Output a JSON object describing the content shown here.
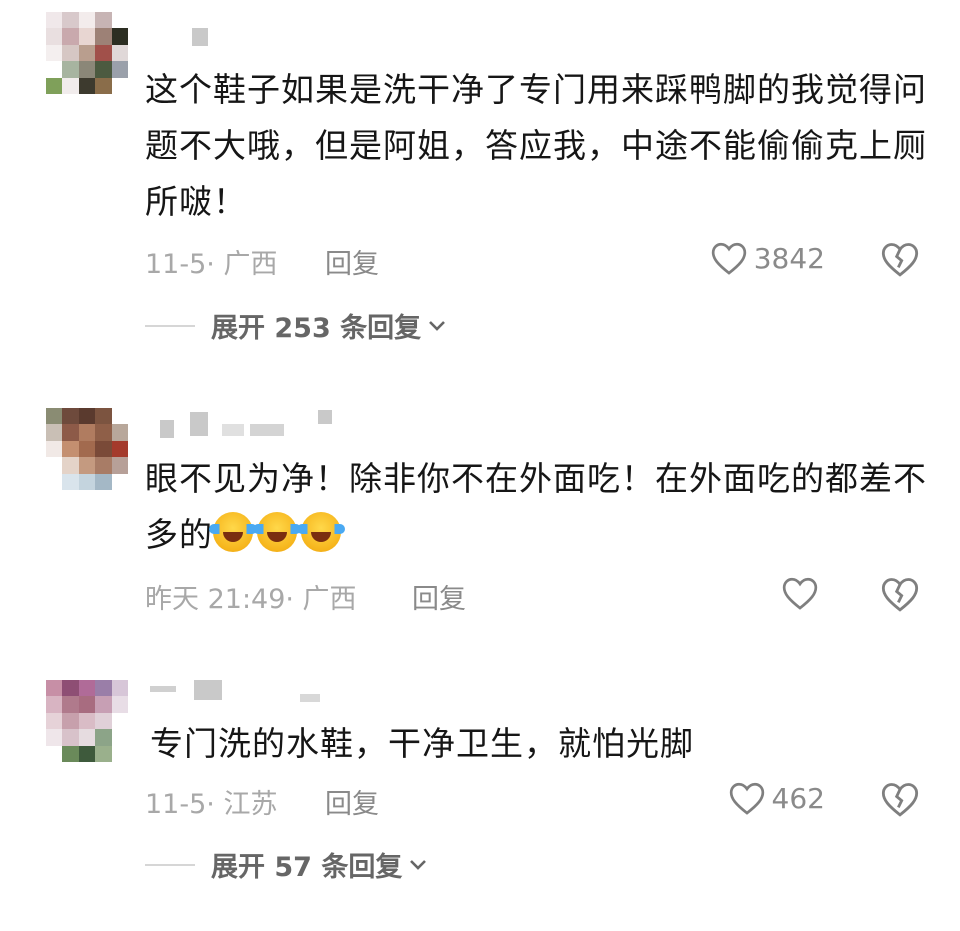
{
  "comments": [
    {
      "text": "这个鞋子如果是洗干净了专门用来踩鸭脚的我觉得问题不大哦，但是阿姐，答应我，中途不能偷偷克上厕所啵！",
      "meta": "11-5· 广西",
      "reply_label": "回复",
      "likes": "3842",
      "expand_label": "展开 253 条回复"
    },
    {
      "text": "眼不见为净！除非你不在外面吃！在外面吃的都差不多的",
      "emoji_count": 3,
      "emoji_name": "crying-laughing-emoji",
      "meta": "昨天 21:49· 广西",
      "reply_label": "回复",
      "likes": ""
    },
    {
      "text": "专门洗的水鞋，干净卫生，就怕光脚",
      "meta": "11-5· 江苏",
      "reply_label": "回复",
      "likes": "462",
      "expand_label": "展开 57 条回复"
    }
  ],
  "icons": {
    "like": "heart-outline-icon",
    "dislike": "broken-heart-icon",
    "expand": "chevron-down-icon"
  }
}
